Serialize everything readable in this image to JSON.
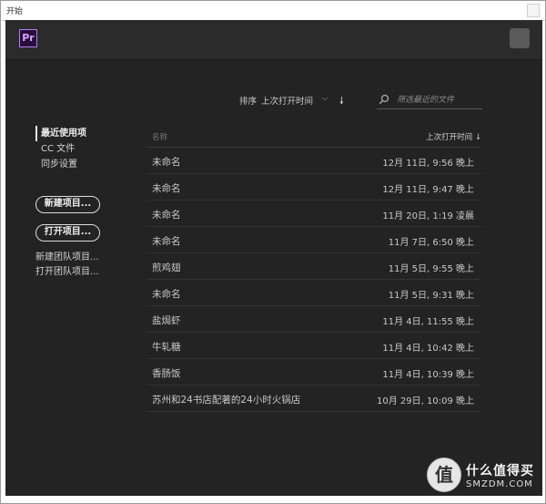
{
  "window": {
    "title": "开始"
  },
  "app": {
    "logo": "Pr"
  },
  "sort": {
    "label": "排序",
    "selected": "上次打开时间",
    "direction_icon": "arrow-down-icon"
  },
  "search": {
    "placeholder": "筛选最近的文件"
  },
  "nav": {
    "items": [
      {
        "label": "最近使用项",
        "active": true
      },
      {
        "label": "CC 文件",
        "active": false
      },
      {
        "label": "同步设置",
        "active": false
      }
    ]
  },
  "actions": {
    "new_project": "新建项目...",
    "open_project": "打开项目...",
    "new_team_project": "新建团队项目...",
    "open_team_project": "打开团队项目..."
  },
  "table": {
    "col_name": "名称",
    "col_time": "上次打开时间 ↓",
    "rows": [
      {
        "name": "未命名",
        "time": "12月 11日, 9:56 晚上"
      },
      {
        "name": "未命名",
        "time": "12月 11日, 9:47 晚上"
      },
      {
        "name": "未命名",
        "time": "11月 20日, 1:19 凌晨"
      },
      {
        "name": "未命名",
        "time": "11月 7日, 6:50 晚上"
      },
      {
        "name": "煎鸡翅",
        "time": "11月 5日, 9:55 晚上"
      },
      {
        "name": "未命名",
        "time": "11月 5日, 9:31 晚上"
      },
      {
        "name": "盐焗虾",
        "time": "11月 4日, 11:55 晚上"
      },
      {
        "name": "牛轧糖",
        "time": "11月 4日, 10:42 晚上"
      },
      {
        "name": "香肠饭",
        "time": "11月 4日, 10:39 晚上"
      },
      {
        "name": "苏州和24书店配著的24小时火锅店",
        "time": "10月 29日, 10:09 晚上"
      }
    ]
  },
  "watermark": {
    "glyph": "值",
    "text": "什么值得买",
    "sub": "SMZDM.COM"
  },
  "colors": {
    "background": "#232323",
    "header": "#2b2b2b",
    "accent": "#b47cf2"
  }
}
